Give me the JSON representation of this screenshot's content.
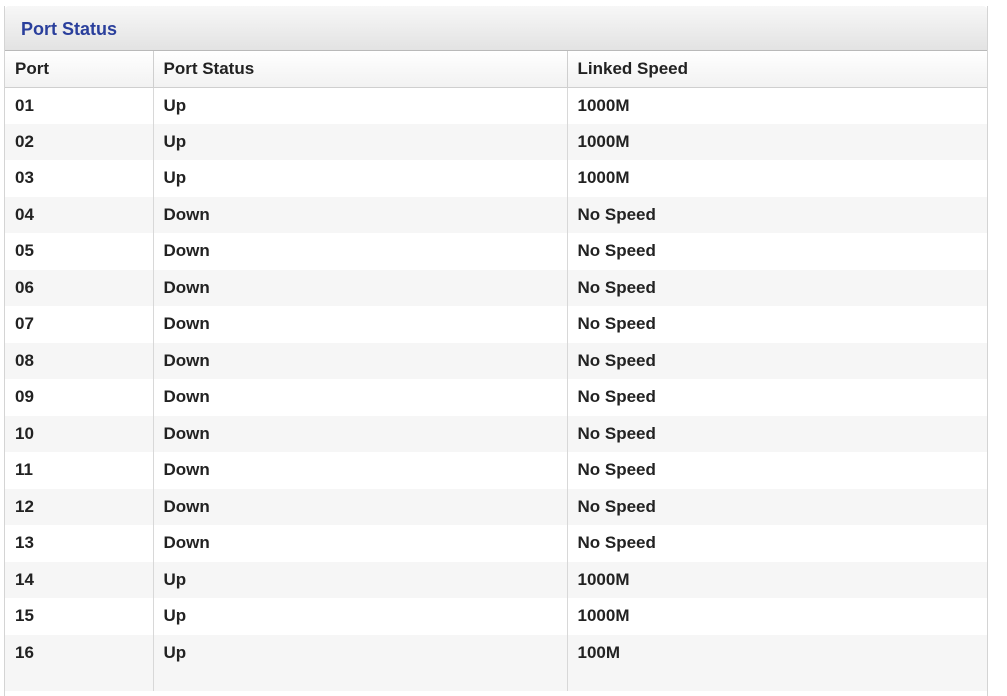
{
  "panel": {
    "title": "Port Status"
  },
  "table": {
    "headers": {
      "port": "Port",
      "status": "Port Status",
      "speed": "Linked Speed"
    },
    "rows": [
      {
        "port": "01",
        "status": "Up",
        "speed": "1000M"
      },
      {
        "port": "02",
        "status": "Up",
        "speed": "1000M"
      },
      {
        "port": "03",
        "status": "Up",
        "speed": "1000M"
      },
      {
        "port": "04",
        "status": "Down",
        "speed": "No Speed"
      },
      {
        "port": "05",
        "status": "Down",
        "speed": "No Speed"
      },
      {
        "port": "06",
        "status": "Down",
        "speed": "No Speed"
      },
      {
        "port": "07",
        "status": "Down",
        "speed": "No Speed"
      },
      {
        "port": "08",
        "status": "Down",
        "speed": "No Speed"
      },
      {
        "port": "09",
        "status": "Down",
        "speed": "No Speed"
      },
      {
        "port": "10",
        "status": "Down",
        "speed": "No Speed"
      },
      {
        "port": "11",
        "status": "Down",
        "speed": "No Speed"
      },
      {
        "port": "12",
        "status": "Down",
        "speed": "No Speed"
      },
      {
        "port": "13",
        "status": "Down",
        "speed": "No Speed"
      },
      {
        "port": "14",
        "status": "Up",
        "speed": "1000M"
      },
      {
        "port": "15",
        "status": "Up",
        "speed": "1000M"
      },
      {
        "port": "16",
        "status": "Up",
        "speed": "100M"
      }
    ]
  },
  "colors": {
    "title": "#2a3f9c",
    "text": "#222222",
    "row_alt": "#f6f6f6"
  }
}
